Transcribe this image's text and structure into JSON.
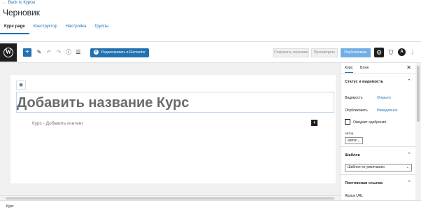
{
  "admin": {
    "back_link": "← Back to Курсы",
    "page_title": "Черновик",
    "tabs": [
      {
        "label": "Курс page"
      },
      {
        "label": "Конструктор"
      },
      {
        "label": "Настройка"
      },
      {
        "label": "Группы"
      }
    ]
  },
  "toolbar": {
    "elementor_label": "Редактировать в Elementor",
    "save_draft_label": "Сохранить черновик",
    "preview_label": "Просмотреть",
    "publish_label": "Опубликовать",
    "astra_letter": "A",
    "accent_color": "#2271b1"
  },
  "editor": {
    "title_placeholder": "Добавить название Курс",
    "content_placeholder": "Курс - Добавить контент"
  },
  "sidebar": {
    "tabs": [
      {
        "label": "Курс"
      },
      {
        "label": "Блок"
      }
    ],
    "status_panel": {
      "title": "Статус и видимость",
      "visibility_label": "Видимость",
      "visibility_value": "Открыто",
      "publish_label": "Опубликовать",
      "publish_value": "Немедленно",
      "pending_label": "Ожидает одобрения",
      "author_label": "Автор",
      "author_value": "admin"
    },
    "template_panel": {
      "title": "Шаблон",
      "select_value": "Шаблон по умолчанию"
    },
    "permalink_panel": {
      "title": "Постоянная ссылка",
      "url_label": "Ярлык URL"
    }
  },
  "footer": {
    "breadcrumb": "Курс"
  }
}
